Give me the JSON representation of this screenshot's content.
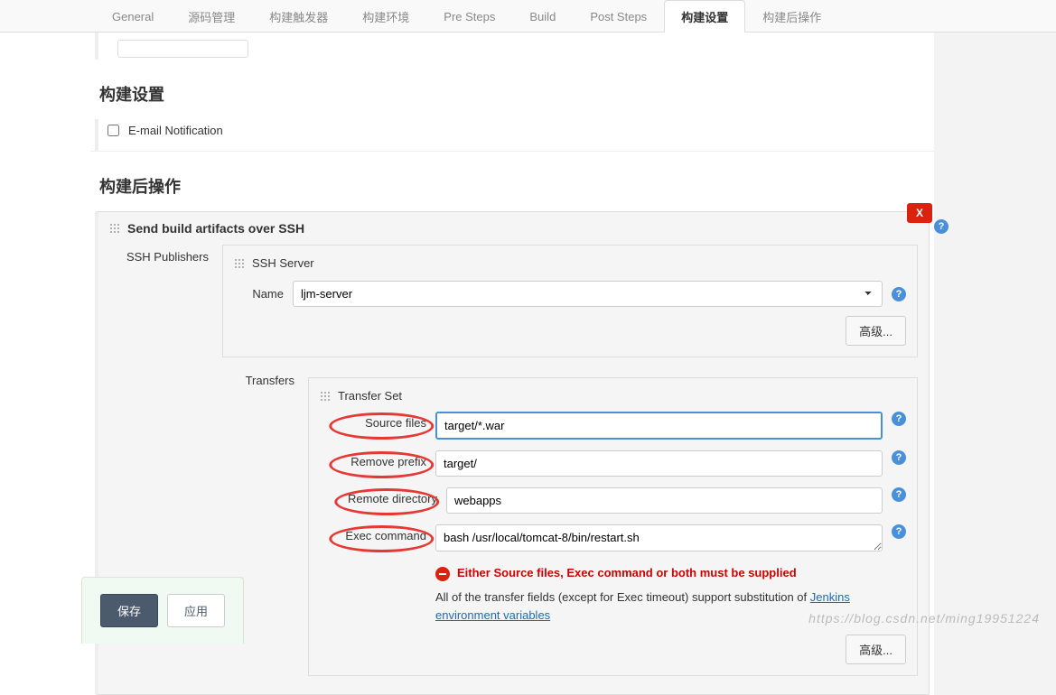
{
  "tabs": {
    "items": [
      "General",
      "源码管理",
      "构建触发器",
      "构建环境",
      "Pre Steps",
      "Build",
      "Post Steps",
      "构建设置",
      "构建后操作"
    ],
    "active_index": 7
  },
  "section_build_settings": {
    "title": "构建设置",
    "email_notification_label": "E-mail Notification"
  },
  "section_post_build": {
    "title": "构建后操作"
  },
  "ssh_block": {
    "title": "Send build artifacts over SSH",
    "delete_label": "X",
    "publishers_label": "SSH Publishers",
    "server_title": "SSH Server",
    "name_label": "Name",
    "name_value": "ljm-server",
    "advanced_label": "高级...",
    "transfers_label": "Transfers",
    "transfer_set_title": "Transfer Set",
    "source_files_label": "Source files",
    "source_files_value": "target/*.war",
    "remove_prefix_label": "Remove prefix",
    "remove_prefix_value": "target/",
    "remote_directory_label": "Remote directory",
    "remote_directory_value": "webapps",
    "exec_command_label": "Exec command",
    "exec_command_value": "bash /usr/local/tomcat-8/bin/restart.sh",
    "error_text": "Either Source files, Exec command or both must be supplied",
    "info_text_prefix": "All of the transfer fields (except for Exec timeout) support substitution of ",
    "info_link_text": "Jenkins environment variables",
    "transfer_advanced_label": "高级..."
  },
  "buttons": {
    "save": "保存",
    "apply": "应用"
  },
  "watermark": "https://blog.csdn.net/ming19951224"
}
